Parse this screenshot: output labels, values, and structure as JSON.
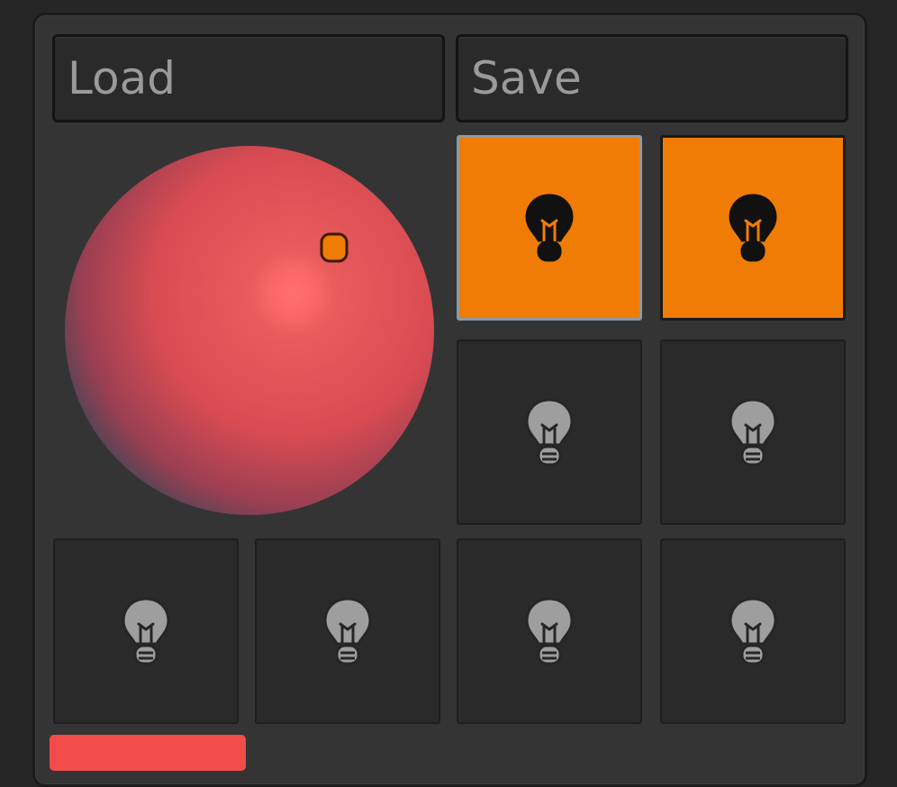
{
  "toolbar": {
    "load_label": "Load",
    "save_label": "Save"
  },
  "material_preview": {
    "sphere_color": "#e85656",
    "highlight_color": "#ff6060",
    "light_indicator_color": "#f07c05"
  },
  "lights": {
    "active_color": "#f07c05",
    "inactive_color": "#2a2a2a",
    "items": [
      {
        "index": 1,
        "state": "on",
        "selected": true,
        "icon": "lightbulb-icon"
      },
      {
        "index": 2,
        "state": "on",
        "selected": false,
        "icon": "lightbulb-icon"
      },
      {
        "index": 3,
        "state": "off",
        "selected": false,
        "icon": "lightbulb-icon"
      },
      {
        "index": 4,
        "state": "off",
        "selected": false,
        "icon": "lightbulb-icon"
      },
      {
        "index": 5,
        "state": "off",
        "selected": false,
        "icon": "lightbulb-icon"
      },
      {
        "index": 6,
        "state": "off",
        "selected": false,
        "icon": "lightbulb-icon"
      },
      {
        "index": 7,
        "state": "off",
        "selected": false,
        "icon": "lightbulb-icon"
      },
      {
        "index": 8,
        "state": "off",
        "selected": false,
        "icon": "lightbulb-icon"
      }
    ]
  },
  "light_color": {
    "swatch_color": "#f24c4a"
  }
}
